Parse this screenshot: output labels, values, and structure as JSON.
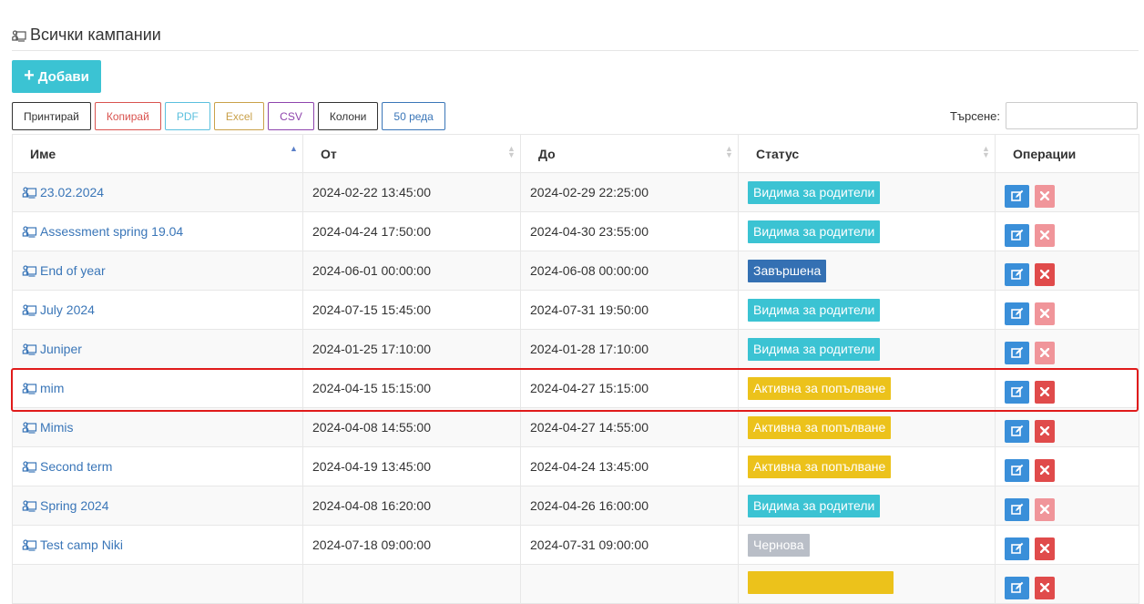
{
  "header": {
    "title": "Всички кампании"
  },
  "add_button": {
    "label": "Добави",
    "icon": "plus-icon"
  },
  "toolbar": [
    {
      "label": "Принтирай",
      "color": "#333333",
      "name": "print-button"
    },
    {
      "label": "Копирай",
      "color": "#d9534f",
      "name": "copy-button"
    },
    {
      "label": "PDF",
      "color": "#5bc0de",
      "name": "pdf-button"
    },
    {
      "label": "Excel",
      "color": "#c9a14a",
      "name": "excel-button"
    },
    {
      "label": "CSV",
      "color": "#8e44ad",
      "name": "csv-button"
    },
    {
      "label": "Колони",
      "color": "#333333",
      "name": "columns-button"
    },
    {
      "label": "50 реда",
      "color": "#3a76b8",
      "name": "page-length-button"
    }
  ],
  "search": {
    "label": "Търсене:",
    "value": ""
  },
  "table": {
    "columns": [
      {
        "label": "Име",
        "sort": "asc"
      },
      {
        "label": "От",
        "sort": "both"
      },
      {
        "label": "До",
        "sort": "both"
      },
      {
        "label": "Статус",
        "sort": "both"
      },
      {
        "label": "Операции",
        "sort": "none"
      }
    ],
    "rows": [
      {
        "name": "23.02.2024",
        "from": "2024-02-22 13:45:00",
        "to": "2024-02-29 22:25:00",
        "status": "Видима за родители",
        "status_color": "#3bc3d3",
        "delete_enabled": false
      },
      {
        "name": "Assessment spring 19.04",
        "from": "2024-04-24 17:50:00",
        "to": "2024-04-30 23:55:00",
        "status": "Видима за родители",
        "status_color": "#3bc3d3",
        "delete_enabled": false
      },
      {
        "name": "End of year",
        "from": "2024-06-01 00:00:00",
        "to": "2024-06-08 00:00:00",
        "status": "Завършена",
        "status_color": "#3470b3",
        "delete_enabled": true
      },
      {
        "name": "July 2024",
        "from": "2024-07-15 15:45:00",
        "to": "2024-07-31 19:50:00",
        "status": "Видима за родители",
        "status_color": "#3bc3d3",
        "delete_enabled": false
      },
      {
        "name": "Juniper",
        "from": "2024-01-25 17:10:00",
        "to": "2024-01-28 17:10:00",
        "status": "Видима за родители",
        "status_color": "#3bc3d3",
        "delete_enabled": false
      },
      {
        "name": "mim",
        "from": "2024-04-15 15:15:00",
        "to": "2024-04-27 15:15:00",
        "status": "Активна за попълване",
        "status_color": "#ecc21b",
        "delete_enabled": true
      },
      {
        "name": "Mimis",
        "from": "2024-04-08 14:55:00",
        "to": "2024-04-27 14:55:00",
        "status": "Активна за попълване",
        "status_color": "#ecc21b",
        "delete_enabled": true
      },
      {
        "name": "Second term",
        "from": "2024-04-19 13:45:00",
        "to": "2024-04-24 13:45:00",
        "status": "Активна за попълване",
        "status_color": "#ecc21b",
        "delete_enabled": true
      },
      {
        "name": "Spring 2024",
        "from": "2024-04-08 16:20:00",
        "to": "2024-04-26 16:00:00",
        "status": "Видима за родители",
        "status_color": "#3bc3d3",
        "delete_enabled": false
      },
      {
        "name": "Test camp Niki",
        "from": "2024-07-18 09:00:00",
        "to": "2024-07-31 09:00:00",
        "status": "Чернова",
        "status_color": "#b9bec7",
        "delete_enabled": true
      },
      {
        "name": "",
        "from": "",
        "to": "",
        "status": "",
        "status_color": "#ecc21b",
        "delete_enabled": true
      }
    ]
  },
  "colors": {
    "edit_button": "#3a8fd9",
    "delete_button": "#e04b4b",
    "delete_button_disabled": "#f0959a",
    "link": "#3a76b8",
    "highlight": "#e01b1b"
  },
  "icons": {
    "campaign": "campaign-icon",
    "edit": "edit-icon",
    "delete": "close-icon"
  }
}
